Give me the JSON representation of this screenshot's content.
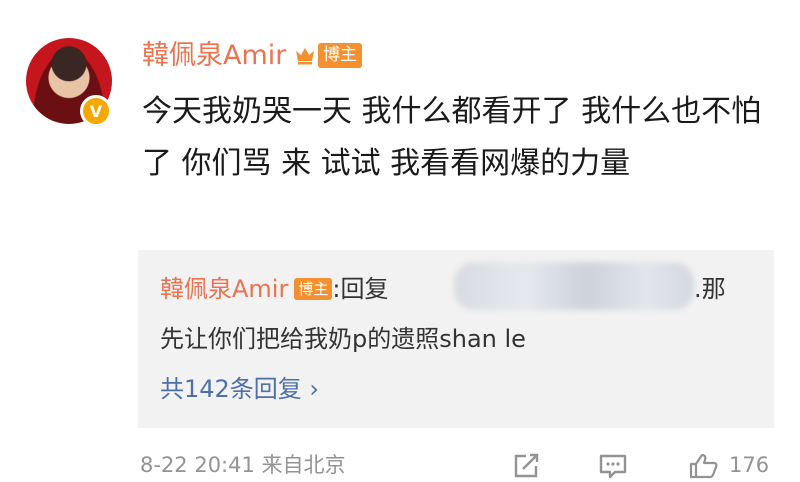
{
  "post": {
    "username": "韓佩泉Amir",
    "badge": "博主",
    "text": "今天我奶哭一天 我什么都看开了 我什么也不怕了 你们骂 来 试试 我看看网爆的力量"
  },
  "reply": {
    "username": "韓佩泉Amir",
    "badge": "博主",
    "prefix": ":回复",
    "suffix": ".那",
    "line2": "先让你们把给我奶p的遗照shan le",
    "more_link": "共142条回复 ›"
  },
  "footer": {
    "time_source": "8-22 20:41 来自北京",
    "like_count": "176",
    "icons": [
      "share-icon",
      "comment-icon",
      "like-icon"
    ]
  },
  "colors": {
    "username": "#eb7350",
    "badge": "#f4902f",
    "link": "#4f6fa8",
    "meta": "#939393"
  }
}
